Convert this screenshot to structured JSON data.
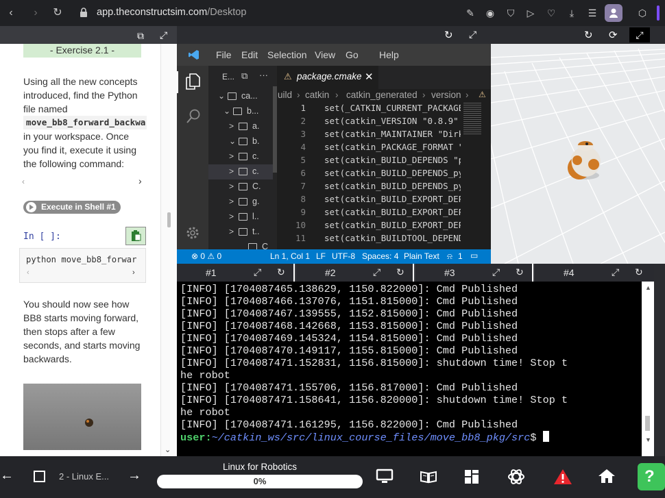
{
  "browser": {
    "url_host": "app.theconstructsim.com",
    "url_path": "/Desktop"
  },
  "notebook": {
    "exercise_heading": "- Exercise 2.1 -",
    "para1_lines": [
      "Using all the new concepts",
      "introduced, find the Python",
      "file named"
    ],
    "filename_code": "move_bb8_forward_backwa",
    "para1_rest": [
      "in your workspace. Once",
      "you find it, execute it using",
      "the following command:"
    ],
    "exec_button": "Execute in Shell #1",
    "in_prompt": "In [ ]:",
    "code": "python move_bb8_forwar",
    "para2_lines": [
      "You should now see how",
      "BB8 starts moving forward,",
      "then stops after a few",
      "seconds, and starts moving",
      "backwards."
    ]
  },
  "vscode": {
    "menu": [
      "File",
      "Edit",
      "Selection",
      "View",
      "Go",
      "Help"
    ],
    "explorer_label": "E...",
    "tab_name": "package.cmake",
    "breadcrumbs": [
      "uild",
      "catkin",
      "catkin_generated",
      "version"
    ],
    "tree": [
      {
        "chevron": "v",
        "label": "ca..."
      },
      {
        "chevron": "v",
        "label": "b..."
      },
      {
        "chevron": ">",
        "label": "a."
      },
      {
        "chevron": "v",
        "label": "b."
      },
      {
        "chevron": ">",
        "label": "c."
      },
      {
        "chevron": ">",
        "label": "c."
      },
      {
        "chevron": ">",
        "label": "C."
      },
      {
        "chevron": ">",
        "label": "g."
      },
      {
        "chevron": ">",
        "label": "l.."
      },
      {
        "chevron": ">",
        "label": "t.."
      },
      {
        "chevron": "",
        "label": "C"
      }
    ],
    "lines": [
      {
        "n": "1",
        "text": "set(_CATKIN_CURRENT_PACKAGE"
      },
      {
        "n": "2",
        "text": "set(catkin_VERSION \"0.8.9\""
      },
      {
        "n": "3",
        "text": "set(catkin_MAINTAINER \"Dirk"
      },
      {
        "n": "4",
        "text": "set(catkin_PACKAGE_FORMAT \""
      },
      {
        "n": "5",
        "text": "set(catkin_BUILD_DEPENDS \"p"
      },
      {
        "n": "6",
        "text": "set(catkin_BUILD_DEPENDS_py"
      },
      {
        "n": "7",
        "text": "set(catkin_BUILD_DEPENDS_py"
      },
      {
        "n": "8",
        "text": "set(catkin_BUILD_EXPORT_DEP"
      },
      {
        "n": "9",
        "text": "set(catkin_BUILD_EXPORT_DEP"
      },
      {
        "n": "10",
        "text": "set(catkin_BUILD_EXPORT_DEP"
      },
      {
        "n": "11",
        "text": "set(catkin_BUILDTOOL_DEPEND"
      }
    ],
    "status": {
      "problems": "⊗ 0 ⚠ 0",
      "position": "Ln 1, Col 1",
      "eol": "LF",
      "encoding": "UTF-8",
      "spaces": "Spaces: 4",
      "language": "Plain Text",
      "notifications": "1"
    }
  },
  "terminal": {
    "tabs": [
      "#1",
      "#2",
      "#3",
      "#4"
    ],
    "lines": [
      "[INFO] [1704087465.138629, 1150.822000]: Cmd Published",
      "[INFO] [1704087466.137076, 1151.815000]: Cmd Published",
      "[INFO] [1704087467.139555, 1152.815000]: Cmd Published",
      "[INFO] [1704087468.142668, 1153.815000]: Cmd Published",
      "[INFO] [1704087469.145324, 1154.815000]: Cmd Published",
      "[INFO] [1704087470.149117, 1155.815000]: Cmd Published",
      "[INFO] [1704087471.152831, 1156.815000]: shutdown time! Stop t",
      "he robot",
      "[INFO] [1704087471.155706, 1156.817000]: Cmd Published",
      "[INFO] [1704087471.158641, 1156.820000]: shutdown time! Stop t",
      "he robot",
      "[INFO] [1704087471.161295, 1156.822000]: Cmd Published"
    ],
    "prompt_user": "user:",
    "prompt_path": "~/catkin_ws/src/linux_course_files/move_bb8_pkg/src",
    "prompt_symbol": "$"
  },
  "bottom": {
    "unit_label": "2 - Linux E...",
    "course_title": "Linux for Robotics",
    "progress_text": "0%",
    "progress_fraction": 0.0
  },
  "colors": {
    "vscode_blue": "#007acc",
    "prompt_green": "#4fd16b",
    "prompt_blue": "#6f8fff",
    "warning_red": "#e8262d",
    "exercise_green": "#d4ecd1"
  }
}
